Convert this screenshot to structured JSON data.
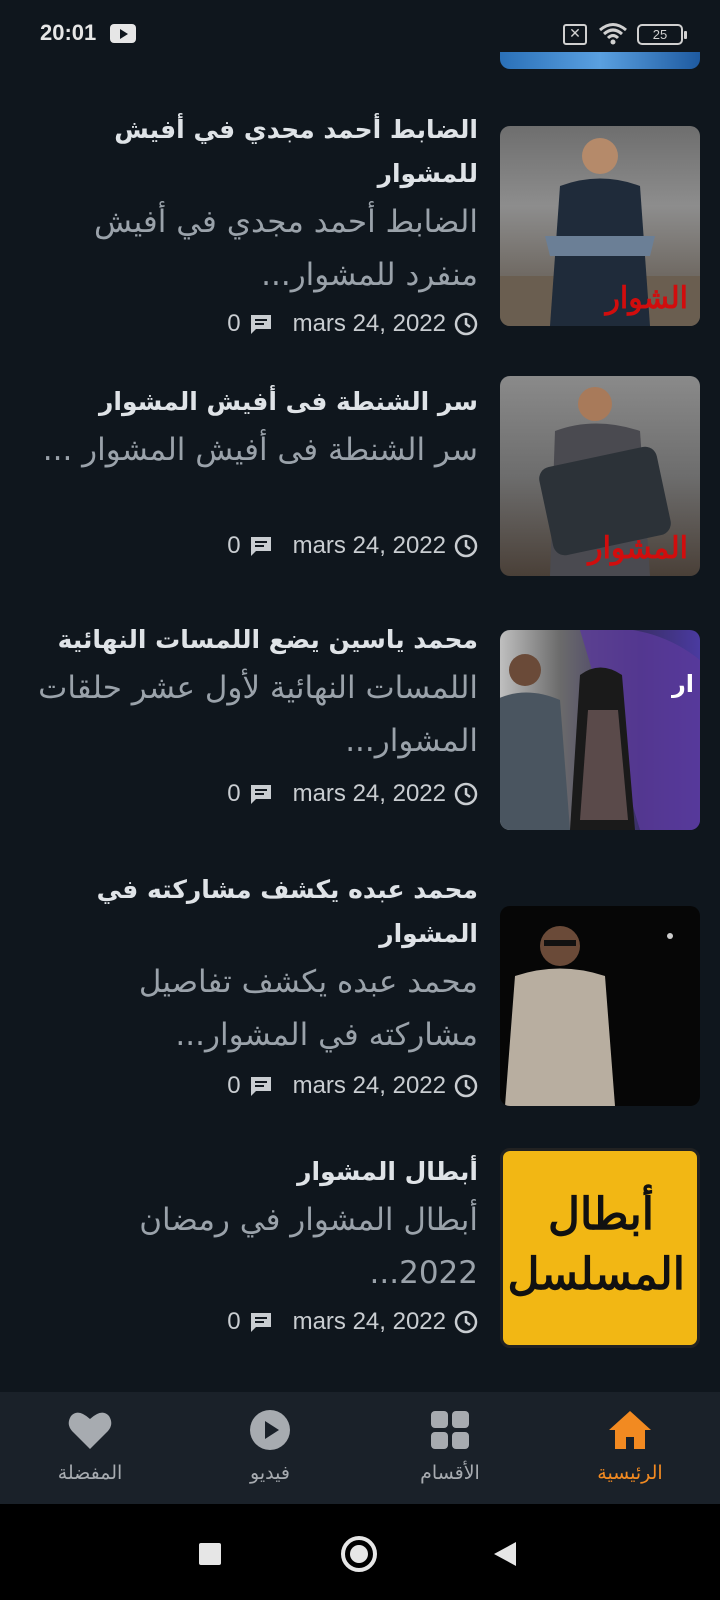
{
  "status_bar": {
    "time": "20:01",
    "battery": "25",
    "icons": [
      "youtube-icon",
      "sim-off-icon",
      "wifi-icon",
      "battery-icon"
    ]
  },
  "articles": [
    {
      "title": "الضابط أحمد مجدي في أفيش للمشوار",
      "excerpt": "الضابط أحمد مجدي في أفيش منفرد للمشوار...",
      "date": "mars 24, 2022",
      "comments": "0",
      "thumb_text": "الشوار"
    },
    {
      "title": "سر الشنطة فى أفيش المشوار",
      "excerpt": "سر الشنطة فى أفيش المشوار ...",
      "date": "mars 24, 2022",
      "comments": "0",
      "thumb_text": "المشوار"
    },
    {
      "title": "محمد ياسين يضع اللمسات النهائية",
      "excerpt": "اللمسات النهائية لأول عشر حلقات المشوار...",
      "date": "mars 24, 2022",
      "comments": "0",
      "thumb_text": "ار"
    },
    {
      "title": "محمد عبده يكشف مشاركته في المشوار",
      "excerpt": "محمد عبده يكشف تفاصيل مشاركته في المشوار...",
      "date": "mars 24, 2022",
      "comments": "0"
    },
    {
      "title": "أبطال المشوار",
      "excerpt": "أبطال المشوار في رمضان 2022...",
      "date": "mars 24, 2022",
      "comments": "0",
      "thumb_text": "أبطال المسلسل"
    }
  ],
  "bottom_nav": {
    "home": "الرئيسية",
    "categories": "الأقسام",
    "video": "فيديو",
    "favorites": "المفضلة",
    "active_color": "#f28a21",
    "inactive_color": "#a7abb0"
  }
}
